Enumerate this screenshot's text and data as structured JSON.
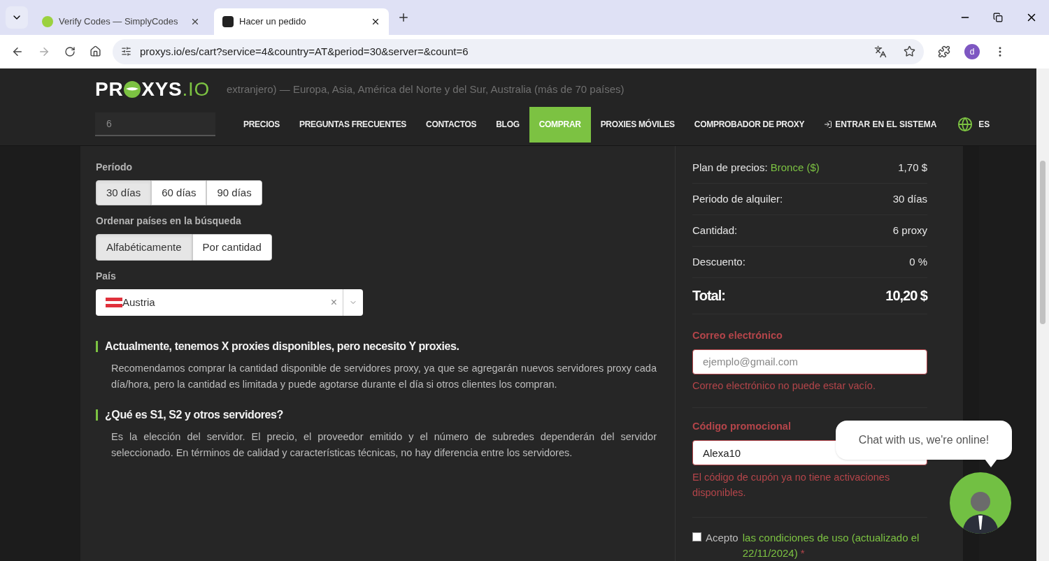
{
  "browser": {
    "tabs": [
      {
        "title": "Verify Codes — SimplyCodes",
        "selected": false
      },
      {
        "title": "Hacer un pedido",
        "selected": true
      }
    ],
    "url": "proxys.io/es/cart?service=4&country=AT&period=30&server=&count=6",
    "profile_initial": "d"
  },
  "header": {
    "logo_left": "PR",
    "logo_mid": "XYS",
    "logo_right": ".IO",
    "backdrop_text": "extranjero) — Europa, Asia, América del Norte y del Sur, Australia (más de 70 países)",
    "backdrop_field": "6",
    "nav": [
      {
        "label": "PRECIOS",
        "selected": false
      },
      {
        "label": "PREGUNTAS FRECUENTES",
        "selected": false
      },
      {
        "label": "CONTACTOS",
        "selected": false
      },
      {
        "label": "BLOG",
        "selected": false
      },
      {
        "label": "COMPRAR",
        "selected": true
      },
      {
        "label": "PROXIES MÓVILES",
        "selected": false
      },
      {
        "label": "COMPROBADOR DE PROXY",
        "selected": false
      }
    ],
    "login": "ENTRAR EN EL SISTEMA",
    "language": {
      "label": "ES",
      "selected": true
    }
  },
  "form": {
    "period": {
      "label": "Período",
      "options": [
        {
          "label": "30 días",
          "selected": true
        },
        {
          "label": "60 días",
          "selected": false
        },
        {
          "label": "90 días",
          "selected": false
        }
      ]
    },
    "sort": {
      "label": "Ordenar países en la búsqueda",
      "options": [
        {
          "label": "Alfabéticamente",
          "selected": true
        },
        {
          "label": "Por cantidad",
          "selected": false
        }
      ]
    },
    "country": {
      "label": "País",
      "value": "Austria",
      "clear": "×"
    }
  },
  "faq": [
    {
      "question": "Actualmente, tenemos X proxies disponibles, pero necesito Y proxies.",
      "answer": "Recomendamos comprar la cantidad disponible de servidores proxy, ya que se agregarán nuevos servidores proxy cada día/hora, pero la cantidad es limitada y puede agotarse durante el día si otros clientes los compran."
    },
    {
      "question": "¿Qué es S1, S2 y otros servidores?",
      "answer": "Es la elección del servidor. El precio, el proveedor emitido y el número de subredes dependerán del servidor seleccionado. En términos de calidad y características técnicas, no hay diferencia entre los servidores."
    }
  ],
  "summary": {
    "rows": [
      {
        "kind": "plan",
        "label": "Plan de precios:",
        "plan": "Bronce ($)",
        "value": "1,70 $"
      },
      {
        "kind": "plain",
        "label": "Periodo de alquiler:",
        "value": "30 días"
      },
      {
        "kind": "plain",
        "label": "Cantidad:",
        "value": "6 proxy"
      },
      {
        "kind": "plain",
        "label": "Descuento:",
        "value": "0 %"
      },
      {
        "kind": "total",
        "label": "Total:",
        "value": "10,20 $"
      }
    ],
    "email": {
      "label": "Correo electrónico",
      "placeholder": "ejemplo@gmail.com",
      "error": "Correo electrónico no puede estar vacío."
    },
    "promo": {
      "label": "Código promocional",
      "value": "Alexa10",
      "error": "El código de cupón ya no tiene activaciones disponibles."
    },
    "terms": {
      "checked": false,
      "prefix": "Acepto",
      "link": "las condiciones de uso (actualizado el 22/11/2024)",
      "required": "*"
    }
  },
  "chat": {
    "bubble": "Chat with us, we're online!"
  }
}
